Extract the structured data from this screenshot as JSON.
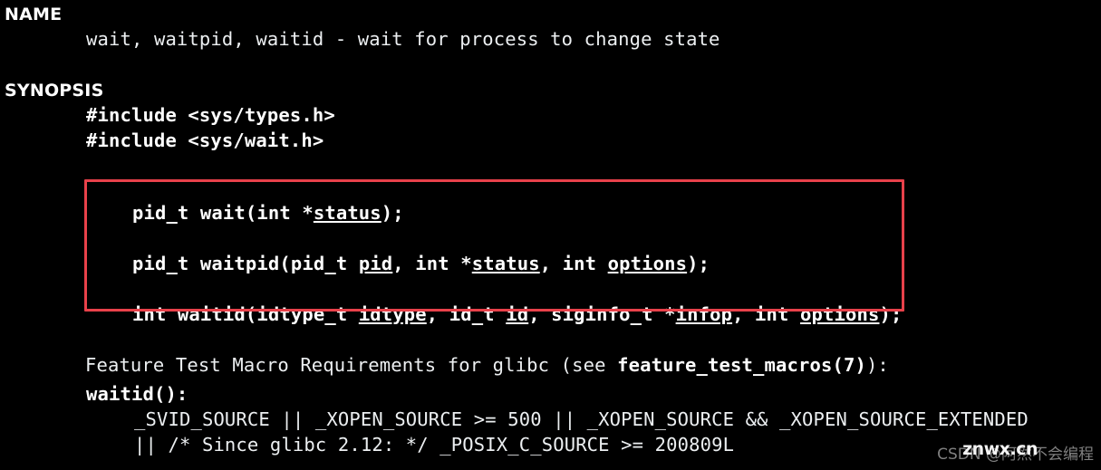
{
  "terminal": {
    "background_color": "#000000",
    "foreground_color": "#f2f2f2",
    "highlight_color": "#e8414a"
  },
  "manpage": {
    "sections": {
      "name_heading": "NAME",
      "synopsis_heading": "SYNOPSIS"
    },
    "name_body": "wait, waitpid, waitid - wait for process to change state",
    "includes": [
      "#include <sys/types.h>",
      "#include <sys/wait.h>"
    ],
    "prototypes": [
      {
        "id": "wait",
        "parts": [
          {
            "text": "pid_t wait(int *",
            "underline": false
          },
          {
            "text": "status",
            "underline": true
          },
          {
            "text": ");",
            "underline": false
          }
        ]
      },
      {
        "id": "waitpid",
        "parts": [
          {
            "text": "pid_t waitpid(pid_t ",
            "underline": false
          },
          {
            "text": "pid",
            "underline": true
          },
          {
            "text": ", int *",
            "underline": false
          },
          {
            "text": "status",
            "underline": true
          },
          {
            "text": ", int ",
            "underline": false
          },
          {
            "text": "options",
            "underline": true
          },
          {
            "text": ");",
            "underline": false
          }
        ]
      },
      {
        "id": "waitid",
        "parts": [
          {
            "text": "int waitid(idtype_t ",
            "underline": false
          },
          {
            "text": "idtype",
            "underline": true
          },
          {
            "text": ", id_t ",
            "underline": false
          },
          {
            "text": "id",
            "underline": true
          },
          {
            "text": ", siginfo_t *",
            "underline": false
          },
          {
            "text": "infop",
            "underline": true
          },
          {
            "text": ", int ",
            "underline": false
          },
          {
            "text": "options",
            "underline": true
          },
          {
            "text": ");",
            "underline": false
          }
        ]
      }
    ],
    "feature_test": {
      "lead": "Feature Test Macro Requirements for glibc (see ",
      "reference": "feature_test_macros(7)",
      "trail": "):",
      "function_label": "waitid():",
      "requirement_line_1": "_SVID_SOURCE || _XOPEN_SOURCE >= 500 || _XOPEN_SOURCE && _XOPEN_SOURCE_EXTENDED",
      "requirement_line_2": "|| /* Since glibc 2.12: */ _POSIX_C_SOURCE >= 200809L"
    }
  },
  "watermark": {
    "base_text": "CSDN @阿然不会编程",
    "overlay_text": "znwx.cn"
  }
}
